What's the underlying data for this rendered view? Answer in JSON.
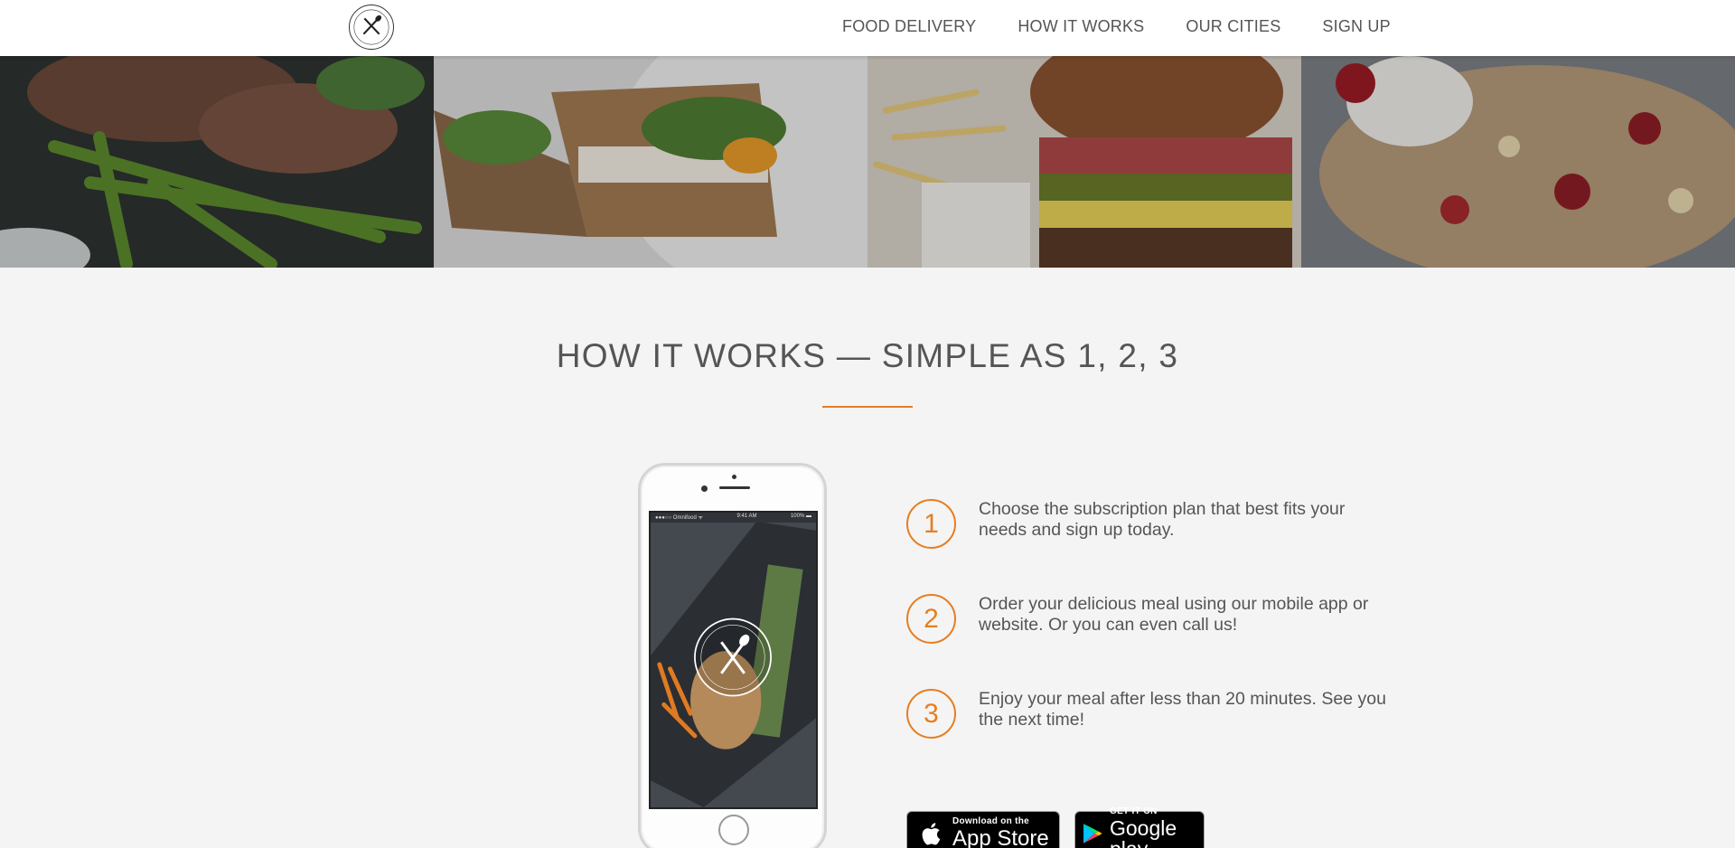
{
  "nav": {
    "logo_icon": "omnifood-logo-icon",
    "links": [
      {
        "label": "FOOD DELIVERY"
      },
      {
        "label": "HOW IT WORKS"
      },
      {
        "label": "OUR CITIES"
      },
      {
        "label": "SIGN UP"
      }
    ]
  },
  "meals": [
    {
      "name": "steak-green-beans"
    },
    {
      "name": "sandwich-salad"
    },
    {
      "name": "burger-fries"
    },
    {
      "name": "granola-cherries"
    }
  ],
  "section": {
    "title": "HOW IT WORKS — SIMPLE AS 1, 2, 3"
  },
  "phone": {
    "status_left": "●●●○○ Omnifood ᯤ",
    "status_time": "9:41 AM",
    "status_right": "100% ▬"
  },
  "steps": [
    {
      "number": "1",
      "text": "Choose the subscription plan that best fits your needs and sign up today."
    },
    {
      "number": "2",
      "text": "Order your delicious meal using our mobile app or website. Or you can even call us!"
    },
    {
      "number": "3",
      "text": "Enjoy your meal after less than 20 minutes. See you the next time!"
    }
  ],
  "badges": {
    "apple": {
      "small": "Download on the",
      "big": "App Store",
      "icon": "apple-icon"
    },
    "google": {
      "small": "GET IT ON",
      "big": "Google play",
      "icon": "google-play-icon"
    }
  },
  "colors": {
    "accent": "#e67e22",
    "background": "#f4f4f4",
    "text": "#555555"
  }
}
